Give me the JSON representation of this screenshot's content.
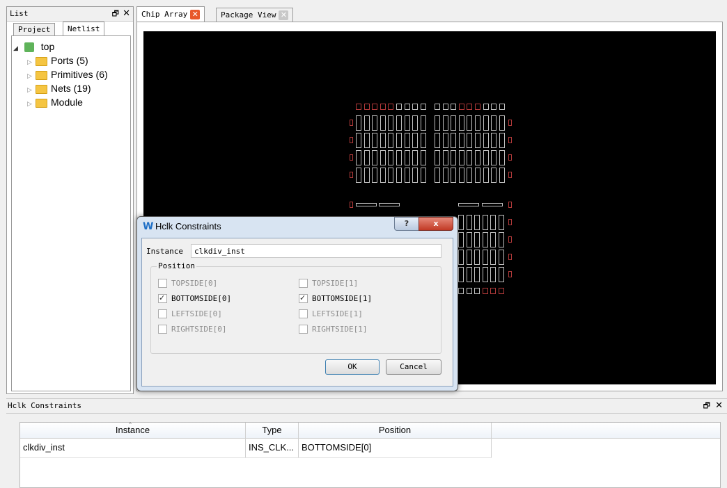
{
  "list_panel": {
    "title": "List",
    "tabs": [
      "Project",
      "Netlist"
    ],
    "tree": {
      "root": "top",
      "children": [
        "Ports (5)",
        "Primitives (6)",
        "Nets (19)",
        "Module"
      ]
    }
  },
  "main_tabs": [
    "Chip Array",
    "Package View"
  ],
  "dialog": {
    "title": "Hclk Constraints",
    "help_glyph": "?",
    "close_glyph": "x",
    "instance_label": "Instance",
    "instance_value": "clkdiv_inst",
    "position_group": "Position",
    "options": [
      {
        "label": "TOPSIDE[0]",
        "checked": false,
        "enabled": false
      },
      {
        "label": "TOPSIDE[1]",
        "checked": false,
        "enabled": false
      },
      {
        "label": "BOTTOMSIDE[0]",
        "checked": true,
        "enabled": true
      },
      {
        "label": "BOTTOMSIDE[1]",
        "checked": true,
        "enabled": true
      },
      {
        "label": "LEFTSIDE[0]",
        "checked": false,
        "enabled": false
      },
      {
        "label": "LEFTSIDE[1]",
        "checked": false,
        "enabled": false
      },
      {
        "label": "RIGHTSIDE[0]",
        "checked": false,
        "enabled": false
      },
      {
        "label": "RIGHTSIDE[1]",
        "checked": false,
        "enabled": false
      }
    ],
    "ok_label": "OK",
    "cancel_label": "Cancel"
  },
  "bottom_panel": {
    "title": "Hclk Constraints",
    "columns": [
      "Instance",
      "Type",
      "Position"
    ],
    "rows": [
      {
        "instance": "clkdiv_inst",
        "type": "INS_CLK...",
        "position": "BOTTOMSIDE[0]"
      }
    ]
  },
  "colors": {
    "chip_background": "#000000",
    "chip_cell": "#c0c0c0",
    "chip_io": "#b23a3a",
    "close_tab": "#e8582a"
  }
}
